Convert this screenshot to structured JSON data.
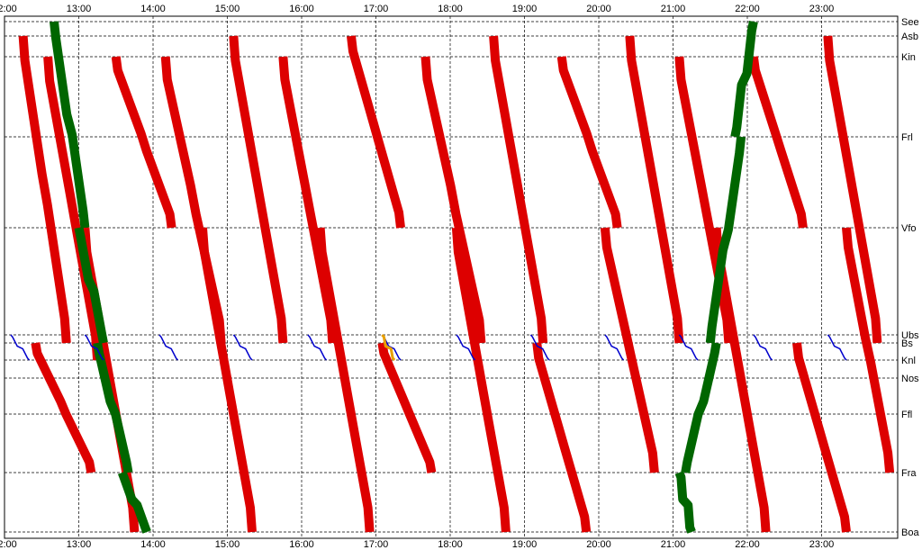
{
  "chart_data": {
    "type": "line",
    "title": "",
    "xlabel": "",
    "ylabel": "",
    "x_ticks": [
      "12:00",
      "13:00",
      "14:00",
      "15:00",
      "16:00",
      "17:00",
      "18:00",
      "19:00",
      "20:00",
      "21:00",
      "22:00",
      "23:00"
    ],
    "stations": [
      "See",
      "Asb",
      "Kin",
      "Frl",
      "Vfo",
      "Ubs",
      "Bs",
      "Knl",
      "Nos",
      "Ffl",
      "Fra",
      "Boa"
    ],
    "xlim": [
      "12:00",
      "24:00"
    ],
    "grid": true,
    "series": [
      {
        "color": "#dd0000",
        "trips": [
          {
            "from": "12:15",
            "to": "12:50",
            "a": "Asb",
            "b": "Bs"
          },
          {
            "from": "12:35",
            "to": "13:15",
            "a": "Kin",
            "b": "Knl"
          },
          {
            "from": "13:05",
            "to": "13:45",
            "a": "Vfo",
            "b": "Boa"
          },
          {
            "from": "12:25",
            "to": "13:10",
            "a": "Bs",
            "b": "Fra"
          },
          {
            "from": "13:30",
            "to": "14:15",
            "a": "Kin",
            "b": "Vfo"
          },
          {
            "from": "14:10",
            "to": "14:55",
            "a": "Kin",
            "b": "Bs"
          },
          {
            "from": "14:40",
            "to": "15:20",
            "a": "Vfo",
            "b": "Boa"
          },
          {
            "from": "15:05",
            "to": "15:45",
            "a": "Asb",
            "b": "Bs"
          },
          {
            "from": "15:45",
            "to": "16:25",
            "a": "Kin",
            "b": "Bs"
          },
          {
            "from": "16:15",
            "to": "16:55",
            "a": "Vfo",
            "b": "Boa"
          },
          {
            "from": "16:40",
            "to": "17:20",
            "a": "Asb",
            "b": "Vfo"
          },
          {
            "from": "17:05",
            "to": "17:45",
            "a": "Bs",
            "b": "Fra"
          },
          {
            "from": "17:40",
            "to": "18:25",
            "a": "Kin",
            "b": "Bs"
          },
          {
            "from": "18:05",
            "to": "18:45",
            "a": "Vfo",
            "b": "Boa"
          },
          {
            "from": "18:35",
            "to": "19:15",
            "a": "Asb",
            "b": "Bs"
          },
          {
            "from": "19:10",
            "to": "19:50",
            "a": "Bs",
            "b": "Boa"
          },
          {
            "from": "19:30",
            "to": "20:15",
            "a": "Kin",
            "b": "Vfo"
          },
          {
            "from": "20:05",
            "to": "20:45",
            "a": "Vfo",
            "b": "Fra"
          },
          {
            "from": "20:25",
            "to": "21:05",
            "a": "Asb",
            "b": "Bs"
          },
          {
            "from": "21:05",
            "to": "21:45",
            "a": "Kin",
            "b": "Bs"
          },
          {
            "from": "21:35",
            "to": "22:15",
            "a": "Vfo",
            "b": "Boa"
          },
          {
            "from": "22:05",
            "to": "22:45",
            "a": "Kin",
            "b": "Vfo"
          },
          {
            "from": "22:40",
            "to": "23:20",
            "a": "Bs",
            "b": "Boa"
          },
          {
            "from": "23:05",
            "to": "23:45",
            "a": "Asb",
            "b": "Bs"
          },
          {
            "from": "23:20",
            "to": "23:55",
            "a": "Vfo",
            "b": "Fra"
          }
        ]
      },
      {
        "color": "#006600",
        "trips": [
          {
            "from": "12:40",
            "to": "13:05",
            "a": "See",
            "b": "Vfo"
          },
          {
            "from": "13:00",
            "to": "13:20",
            "a": "Vfo",
            "b": "Bs"
          },
          {
            "from": "13:15",
            "to": "13:40",
            "a": "Bs",
            "b": "Fra"
          },
          {
            "from": "13:35",
            "to": "13:55",
            "a": "Fra",
            "b": "Boa"
          },
          {
            "from": "21:05",
            "to": "21:15",
            "a": "Fra",
            "b": "Boa"
          },
          {
            "from": "21:10",
            "to": "21:35",
            "a": "Fra",
            "b": "Bs"
          },
          {
            "from": "21:30",
            "to": "21:55",
            "a": "Bs",
            "b": "Frl"
          },
          {
            "from": "21:50",
            "to": "22:05",
            "a": "Frl",
            "b": "See"
          }
        ]
      },
      {
        "color": "#0000cc",
        "trips": [
          {
            "from": "12:05",
            "to": "12:20",
            "a": "Ubs",
            "b": "Knl"
          },
          {
            "from": "13:05",
            "to": "13:20",
            "a": "Ubs",
            "b": "Knl"
          },
          {
            "from": "14:05",
            "to": "14:20",
            "a": "Ubs",
            "b": "Knl"
          },
          {
            "from": "15:05",
            "to": "15:20",
            "a": "Ubs",
            "b": "Knl"
          },
          {
            "from": "16:05",
            "to": "16:20",
            "a": "Ubs",
            "b": "Knl"
          },
          {
            "from": "17:05",
            "to": "17:20",
            "a": "Ubs",
            "b": "Knl"
          },
          {
            "from": "18:05",
            "to": "18:20",
            "a": "Ubs",
            "b": "Knl"
          },
          {
            "from": "19:05",
            "to": "19:20",
            "a": "Ubs",
            "b": "Knl"
          },
          {
            "from": "20:05",
            "to": "20:20",
            "a": "Ubs",
            "b": "Knl"
          },
          {
            "from": "21:05",
            "to": "21:20",
            "a": "Ubs",
            "b": "Knl"
          },
          {
            "from": "22:05",
            "to": "22:20",
            "a": "Ubs",
            "b": "Knl"
          },
          {
            "from": "23:05",
            "to": "23:20",
            "a": "Ubs",
            "b": "Knl"
          }
        ]
      },
      {
        "color": "#e8a000",
        "trips": [
          {
            "from": "17:05",
            "to": "17:15",
            "a": "Ubs",
            "b": "Knl"
          }
        ]
      }
    ]
  }
}
